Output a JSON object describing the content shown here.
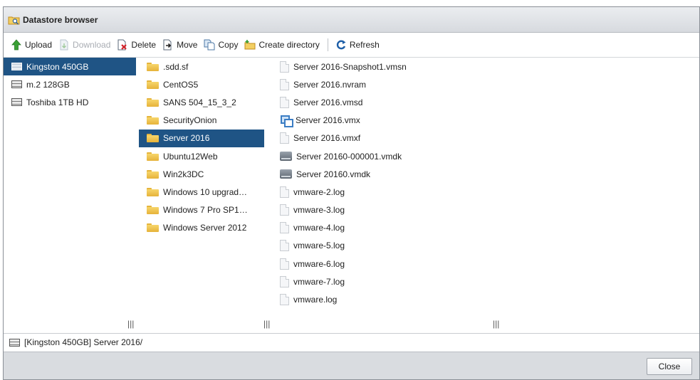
{
  "dialog": {
    "title": "Datastore browser",
    "title_icon": "datastore-browser-icon"
  },
  "toolbar": {
    "upload": {
      "label": "Upload",
      "icon": "upload-arrow-icon",
      "enabled": true
    },
    "download": {
      "label": "Download",
      "icon": "download-icon",
      "enabled": false
    },
    "delete": {
      "label": "Delete",
      "icon": "delete-icon",
      "enabled": true
    },
    "move": {
      "label": "Move",
      "icon": "move-icon",
      "enabled": true
    },
    "copy": {
      "label": "Copy",
      "icon": "copy-icon",
      "enabled": true
    },
    "create_directory": {
      "label": "Create directory",
      "icon": "new-folder-icon",
      "enabled": true
    },
    "refresh": {
      "label": "Refresh",
      "icon": "refresh-icon",
      "enabled": true
    }
  },
  "datastores": [
    {
      "label": "Kingston 450GB",
      "selected": true
    },
    {
      "label": "m.2 128GB",
      "selected": false
    },
    {
      "label": "Toshiba 1TB HD",
      "selected": false
    }
  ],
  "folders": [
    {
      "label": ".sdd.sf",
      "selected": false
    },
    {
      "label": "CentOS5",
      "selected": false
    },
    {
      "label": "SANS 504_15_3_2",
      "selected": false
    },
    {
      "label": "SecurityOnion",
      "selected": false
    },
    {
      "label": "Server 2016",
      "selected": true
    },
    {
      "label": "Ubuntu12Web",
      "selected": false
    },
    {
      "label": "Win2k3DC",
      "selected": false
    },
    {
      "label": "Windows 10 upgrad…",
      "selected": false
    },
    {
      "label": "Windows 7 Pro SP1…",
      "selected": false
    },
    {
      "label": "Windows Server 2012",
      "selected": false
    }
  ],
  "files": [
    {
      "label": "Server 2016-Snapshot1.vmsn",
      "icon": "file-icon"
    },
    {
      "label": "Server 2016.nvram",
      "icon": "file-icon"
    },
    {
      "label": "Server 2016.vmsd",
      "icon": "file-icon"
    },
    {
      "label": "Server 2016.vmx",
      "icon": "vm-config-icon"
    },
    {
      "label": "Server 2016.vmxf",
      "icon": "file-icon"
    },
    {
      "label": "Server 20160-000001.vmdk",
      "icon": "disk-icon"
    },
    {
      "label": "Server 20160.vmdk",
      "icon": "disk-icon"
    },
    {
      "label": "vmware-2.log",
      "icon": "file-icon"
    },
    {
      "label": "vmware-3.log",
      "icon": "file-icon"
    },
    {
      "label": "vmware-4.log",
      "icon": "file-icon"
    },
    {
      "label": "vmware-5.log",
      "icon": "file-icon"
    },
    {
      "label": "vmware-6.log",
      "icon": "file-icon"
    },
    {
      "label": "vmware-7.log",
      "icon": "file-icon"
    },
    {
      "label": "vmware.log",
      "icon": "file-icon"
    }
  ],
  "resize_grip": "|||",
  "path": "[Kingston 450GB] Server 2016/",
  "footer": {
    "close_label": "Close"
  },
  "colors": {
    "selection": "#1f5485",
    "footer": "#d9dce0"
  }
}
